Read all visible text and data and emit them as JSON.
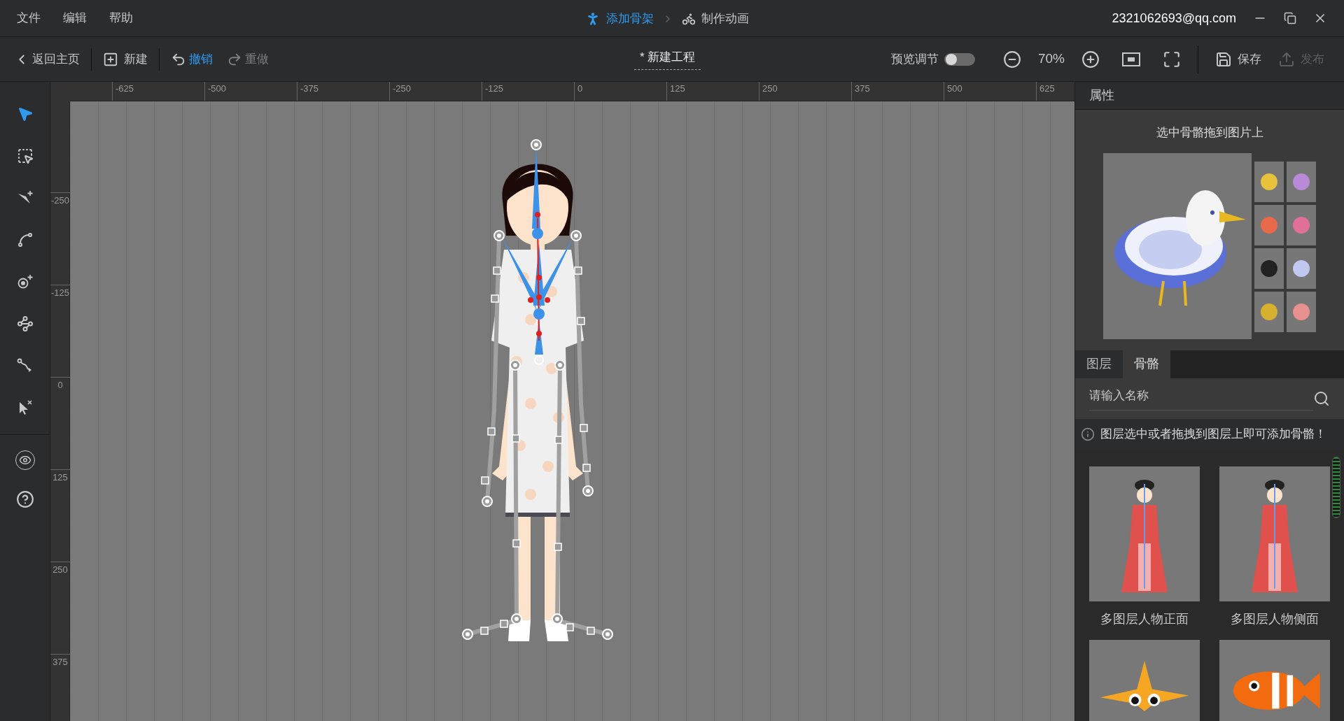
{
  "menu": [
    {
      "label": "文件"
    },
    {
      "label": "编辑"
    },
    {
      "label": "帮助"
    }
  ],
  "steps": [
    {
      "label": "添加骨架",
      "selected": true
    },
    {
      "label": "制作动画",
      "selected": false
    }
  ],
  "account": "2321062693@qq.com",
  "toolbar": {
    "back": "返回主页",
    "new": "新建",
    "undo": {
      "label": "撤销",
      "disabled": false
    },
    "redo": {
      "label": "重做",
      "disabled": true
    },
    "project_title": "* 新建工程",
    "preview": {
      "label": "预览调节",
      "on": false
    },
    "zoom": "70%",
    "save": {
      "label": "保存",
      "disabled": false
    },
    "publish": {
      "label": "发布",
      "disabled": true
    }
  },
  "tools": [
    {
      "kind": "select",
      "selected": true
    },
    {
      "kind": "marquee",
      "selected": false
    },
    {
      "kind": "add-bone",
      "selected": false
    },
    {
      "kind": "curve",
      "selected": false
    },
    {
      "kind": "add-joint",
      "selected": false
    },
    {
      "kind": "connect",
      "selected": false
    },
    {
      "kind": "path",
      "selected": false
    },
    {
      "kind": "remove",
      "selected": false
    }
  ],
  "extra_tools": [
    {
      "kind": "view"
    },
    {
      "kind": "help"
    }
  ],
  "rulers": {
    "horizontal": [
      "-625",
      "-500",
      "-375",
      "-250",
      "-125",
      "0",
      "125",
      "250",
      "375",
      "500",
      "625"
    ],
    "vertical": [
      "-250",
      "-125",
      "0",
      "125",
      "250",
      "375"
    ]
  },
  "properties": {
    "title": "属性",
    "hint": "选中骨骼拖到图片上"
  },
  "tabs": [
    {
      "label": "图层",
      "selected": false
    },
    {
      "label": "骨骼",
      "selected": true
    }
  ],
  "search": {
    "placeholder": "请输入名称"
  },
  "info": "图层选中或者拖拽到图层上即可添加骨骼！",
  "templates": [
    {
      "kind": "figure",
      "label": "多图层人物正面"
    },
    {
      "kind": "figure",
      "label": "多图层人物侧面"
    },
    {
      "kind": "starfish"
    },
    {
      "kind": "fish"
    }
  ]
}
